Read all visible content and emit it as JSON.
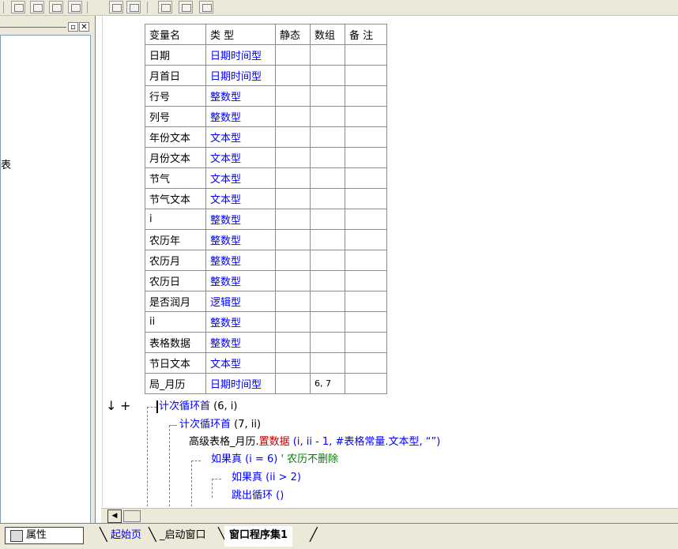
{
  "panel": {
    "min_glyph": "▫",
    "close_glyph": "✕",
    "truncated_text": "表"
  },
  "table": {
    "headers": [
      "变量名",
      "类 型",
      "静态",
      "数组",
      "备 注"
    ],
    "rows": [
      {
        "name": "日期",
        "type": "日期时间型",
        "static": "",
        "array": "",
        "note": ""
      },
      {
        "name": "月首日",
        "type": "日期时间型",
        "static": "",
        "array": "",
        "note": ""
      },
      {
        "name": "行号",
        "type": "整数型",
        "static": "",
        "array": "",
        "note": ""
      },
      {
        "name": "列号",
        "type": "整数型",
        "static": "",
        "array": "",
        "note": ""
      },
      {
        "name": "年份文本",
        "type": "文本型",
        "static": "",
        "array": "",
        "note": ""
      },
      {
        "name": "月份文本",
        "type": "文本型",
        "static": "",
        "array": "",
        "note": ""
      },
      {
        "name": "节气",
        "type": "文本型",
        "static": "",
        "array": "",
        "note": ""
      },
      {
        "name": "节气文本",
        "type": "文本型",
        "static": "",
        "array": "",
        "note": ""
      },
      {
        "name": "i",
        "type": "整数型",
        "static": "",
        "array": "",
        "note": ""
      },
      {
        "name": "农历年",
        "type": "整数型",
        "static": "",
        "array": "",
        "note": ""
      },
      {
        "name": "农历月",
        "type": "整数型",
        "static": "",
        "array": "",
        "note": ""
      },
      {
        "name": "农历日",
        "type": "整数型",
        "static": "",
        "array": "",
        "note": ""
      },
      {
        "name": "是否润月",
        "type": "逻辑型",
        "static": "",
        "array": "",
        "note": ""
      },
      {
        "name": "ii",
        "type": "整数型",
        "static": "",
        "array": "",
        "note": ""
      },
      {
        "name": "表格数据",
        "type": "整数型",
        "static": "",
        "array": "",
        "note": ""
      },
      {
        "name": "节日文本",
        "type": "文本型",
        "static": "",
        "array": "",
        "note": ""
      },
      {
        "name": "局_月历",
        "type": "日期时间型",
        "static": "",
        "array": "6, 7",
        "note": ""
      }
    ]
  },
  "code": {
    "markers": {
      "arrow": "↓",
      "plus": "+"
    },
    "l1_kw": "计次循环首",
    "l1_args": " (6, i)",
    "l2_kw": "计次循环首",
    "l2_args": " (7, ii)",
    "l3_obj": "高级表格_月历.",
    "l3_method": "置数据",
    "l3_args": " (i, ii - 1, #表格常量.文本型, “”)",
    "l4_kw": "如果真",
    "l4_args": " (i = 6)",
    "l4_comment": " ' 农历不删除",
    "l5_kw": "如果真",
    "l5_args": " (ii > 2)",
    "l6_kw": "跳出循环",
    "l6_args": " ()"
  },
  "bottom": {
    "properties_tab": "属性",
    "tabs": [
      "起始页",
      "_启动窗口",
      "窗口程序集1"
    ]
  }
}
